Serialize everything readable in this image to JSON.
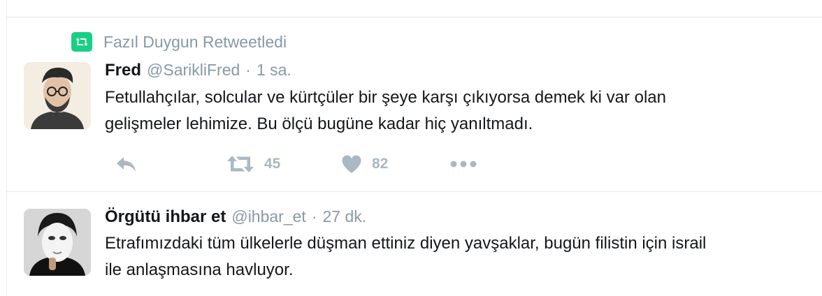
{
  "tweets": [
    {
      "retweet_context": "Fazıl Duygun Retweetledi",
      "fullname": "Fred",
      "username": "@SarikliFred",
      "separator": "·",
      "time": "1 sa.",
      "text": "Fetullahçılar, solcular ve kürtçüler bir şeye karşı çıkıyorsa demek ki var olan\ngelişmeler lehimize. Bu ölçü bugüne kadar hiç yanıltmadı.",
      "retweet_count": "45",
      "like_count": "82",
      "icons": [
        "retweet-badge-icon",
        "reply-icon",
        "retweet-icon",
        "heart-icon",
        "more-icon"
      ]
    },
    {
      "fullname": "Örgütü ihbar et",
      "username": "@ihbar_et",
      "separator": "·",
      "time": "27 dk.",
      "text": "Etrafımızdaki tüm ülkelerle düşman ettiniz diyen yavşaklar, bugün filistin için israil\nile anlaşmasına havluyor."
    }
  ],
  "colors": {
    "retweet_green": "#19cf86",
    "secondary_text": "#8899a6",
    "action_gray": "#aab8c2",
    "border": "#e1e8ed"
  }
}
